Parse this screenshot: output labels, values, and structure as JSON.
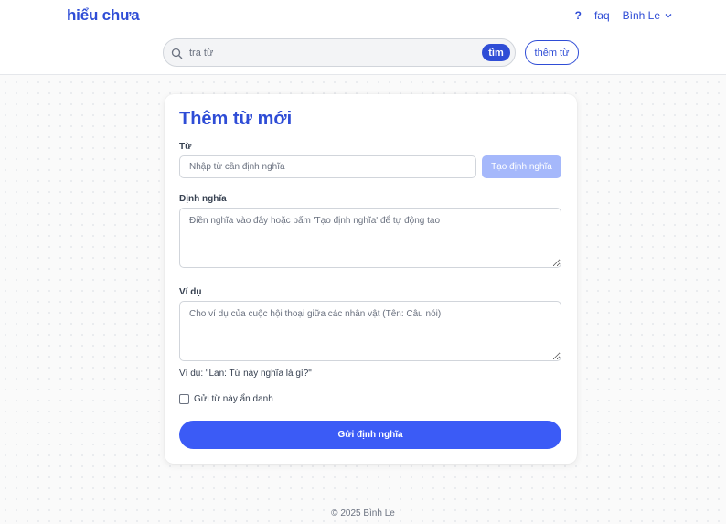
{
  "header": {
    "logo": "hiểu chưa",
    "nav": {
      "help": "?",
      "faq": "faq",
      "user": "Bình Le"
    }
  },
  "search": {
    "placeholder": "tra từ",
    "button": "tìm",
    "add_word": "thêm từ"
  },
  "form": {
    "title": "Thêm từ mới",
    "word_label": "Từ",
    "word_placeholder": "Nhập từ cần định nghĩa",
    "generate_button": "Tạo định nghĩa",
    "definition_label": "Định nghĩa",
    "definition_placeholder": "Điền nghĩa vào đây hoặc bấm 'Tạo định nghĩa' để tự động tạo",
    "example_label": "Ví dụ",
    "example_placeholder": "Cho ví dụ của cuộc hội thoại giữa các nhân vật (Tên: Câu nói)",
    "example_hint": "Ví dụ: \"Lan: Từ này nghĩa là gì?\"",
    "anonymous_label": "Gửi từ này ẩn danh",
    "anonymous_checked": false,
    "submit_button": "Gửi định nghĩa"
  },
  "footer": {
    "copyright": "© 2025 Bình Le"
  },
  "colors": {
    "brand": "#2f4dd6",
    "primary_button": "#3b5bf6",
    "disabled_button": "#a5b8fb"
  }
}
